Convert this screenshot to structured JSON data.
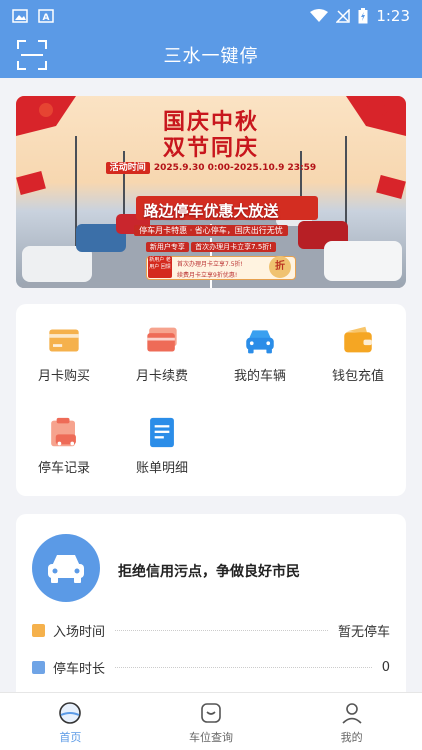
{
  "status_bar": {
    "time": "1:23",
    "left_icons": [
      "image-icon",
      "font-a-icon"
    ],
    "right_icons": [
      "wifi-icon",
      "signal-off-icon",
      "battery-charging-icon"
    ]
  },
  "app_bar": {
    "title": "三水一键停",
    "scan_icon": "scan-icon",
    "color": "#5b9ae6"
  },
  "banner": {
    "headline_line1": "国庆中秋",
    "headline_line2": "双节同庆",
    "activity_tag": "活动时间",
    "activity_time": "2025.9.30 0:00-2025.10.9 23:59",
    "promo": "路边停车优惠大放送",
    "sub_line": "停车月卡特惠 · 省心停车，国庆出行无忧",
    "new_user_tag": "新用户专享",
    "new_user_offer": "首次办理月卡立享7.5折!",
    "badge_text": "新用户 老用户 回馈",
    "offer_line1": "首次办理月卡立享7.5折!",
    "offer_line2": "续费月卡立享9折优惠!",
    "zhe": "折"
  },
  "menu": {
    "items": [
      {
        "label": "月卡购买",
        "icon": "card-icon"
      },
      {
        "label": "月卡续费",
        "icon": "card-stack-icon"
      },
      {
        "label": "我的车辆",
        "icon": "car-icon"
      },
      {
        "label": "钱包充值",
        "icon": "wallet-icon"
      },
      {
        "label": "停车记录",
        "icon": "parking-record-icon"
      },
      {
        "label": "账单明细",
        "icon": "bill-icon"
      }
    ]
  },
  "info": {
    "slogan": "拒绝信用污点，争做良好市民",
    "car_icon": "car-icon",
    "rows": [
      {
        "label": "入场时间",
        "value": "暂无停车",
        "color": "#f5b14c"
      },
      {
        "label": "停车时长",
        "value": "0",
        "color": "#6fa4e6"
      }
    ]
  },
  "tabbar": {
    "tabs": [
      {
        "label": "首页",
        "icon": "home-icon",
        "active": true
      },
      {
        "label": "车位查询",
        "icon": "parking-search-icon",
        "active": false
      },
      {
        "label": "我的",
        "icon": "user-icon",
        "active": false
      }
    ],
    "active_color": "#5b9ae6"
  }
}
